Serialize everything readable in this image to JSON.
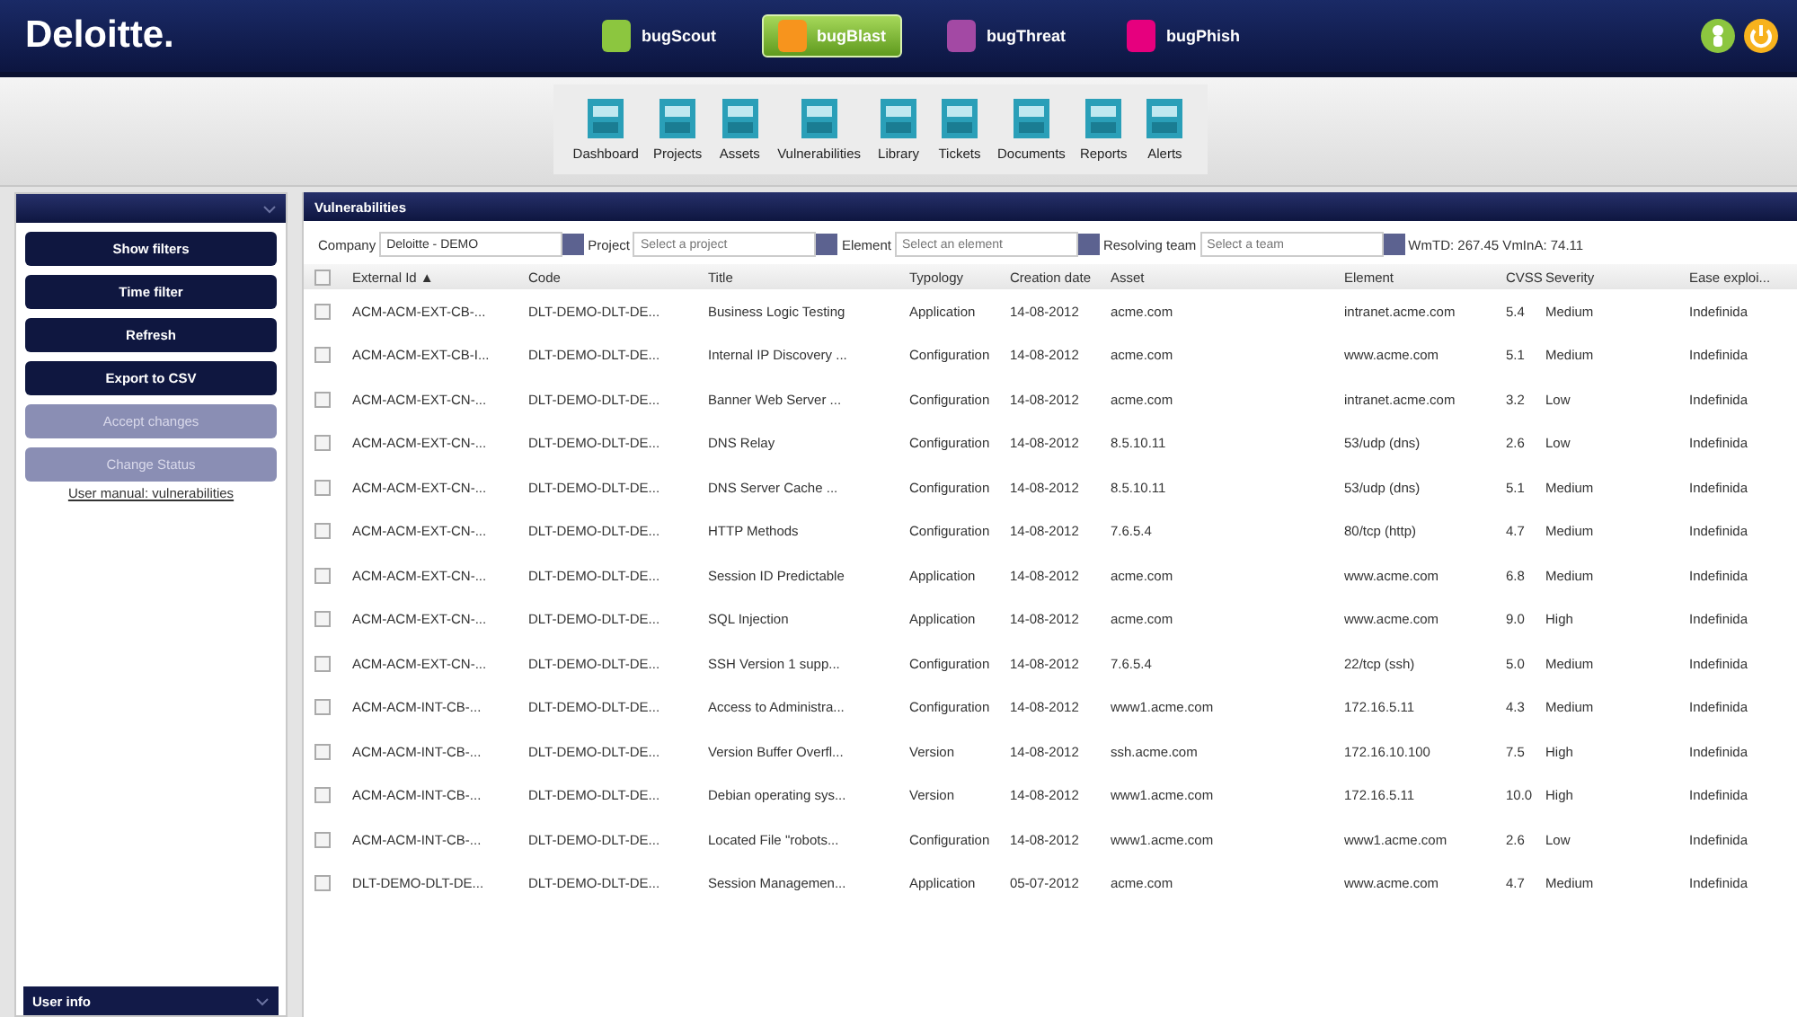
{
  "header": {
    "logo": "Deloitte.",
    "apps": [
      {
        "label": "bugScout",
        "color": "#8cc63f",
        "selected": false
      },
      {
        "label": "bugBlast",
        "color": "#f7941d",
        "selected": true
      },
      {
        "label": "bugThreat",
        "color": "#a349a4",
        "selected": false
      },
      {
        "label": "bugPhish",
        "color": "#e6007e",
        "selected": false
      }
    ]
  },
  "toolbar": [
    "Dashboard",
    "Projects",
    "Assets",
    "Vulnerabilities",
    "Library",
    "Tickets",
    "Documents",
    "Reports",
    "Alerts"
  ],
  "sidebar": {
    "buttons": [
      {
        "label": "Show filters",
        "disabled": false
      },
      {
        "label": "Time filter",
        "disabled": false
      },
      {
        "label": "Refresh",
        "disabled": false
      },
      {
        "label": "Export to CSV",
        "disabled": false
      },
      {
        "label": "Accept changes",
        "disabled": true
      },
      {
        "label": "Change Status",
        "disabled": true
      }
    ],
    "link": "User manual: vulnerabilities",
    "footer": "User info"
  },
  "panel": {
    "title": "Vulnerabilities",
    "filters": [
      {
        "label": "Company",
        "value": "Deloitte - DEMO"
      },
      {
        "label": "Project",
        "placeholder": "Select a project"
      },
      {
        "label": "Element",
        "placeholder": "Select an element"
      },
      {
        "label": "Resolving team",
        "placeholder": "Select a team"
      }
    ],
    "stats": "WmTD: 267.45  VmInA: 74.11",
    "table": {
      "all_checked": false,
      "columns": [
        "External Id ▲",
        "Code",
        "Title",
        "Typology",
        "Creation date",
        "Asset",
        "Element",
        "CVSS",
        "Severity",
        "Ease exploi..."
      ],
      "rows": [
        {
          "checked": false,
          "cells": [
            "ACM-ACM-EXT-CB-...",
            "DLT-DEMO-DLT-DE...",
            "Business Logic Testing",
            "Application",
            "14-08-2012",
            "acme.com",
            "intranet.acme.com",
            "5.4",
            "Medium",
            "Indefinida"
          ]
        },
        {
          "checked": false,
          "cells": [
            "ACM-ACM-EXT-CB-I...",
            "DLT-DEMO-DLT-DE...",
            "Internal IP Discovery ...",
            "Configuration",
            "14-08-2012",
            "acme.com",
            "www.acme.com",
            "5.1",
            "Medium",
            "Indefinida"
          ]
        },
        {
          "checked": false,
          "cells": [
            "ACM-ACM-EXT-CN-...",
            "DLT-DEMO-DLT-DE...",
            "Banner Web Server ...",
            "Configuration",
            "14-08-2012",
            "acme.com",
            "intranet.acme.com",
            "3.2",
            "Low",
            "Indefinida"
          ]
        },
        {
          "checked": false,
          "cells": [
            "ACM-ACM-EXT-CN-...",
            "DLT-DEMO-DLT-DE...",
            "DNS Relay",
            "Configuration",
            "14-08-2012",
            "8.5.10.11",
            "53/udp (dns)",
            "2.6",
            "Low",
            "Indefinida"
          ]
        },
        {
          "checked": false,
          "cells": [
            "ACM-ACM-EXT-CN-...",
            "DLT-DEMO-DLT-DE...",
            "DNS Server Cache ...",
            "Configuration",
            "14-08-2012",
            "8.5.10.11",
            "53/udp (dns)",
            "5.1",
            "Medium",
            "Indefinida"
          ]
        },
        {
          "checked": false,
          "cells": [
            "ACM-ACM-EXT-CN-...",
            "DLT-DEMO-DLT-DE...",
            "HTTP Methods",
            "Configuration",
            "14-08-2012",
            "7.6.5.4",
            "80/tcp (http)",
            "4.7",
            "Medium",
            "Indefinida"
          ]
        },
        {
          "checked": false,
          "cells": [
            "ACM-ACM-EXT-CN-...",
            "DLT-DEMO-DLT-DE...",
            "Session ID Predictable",
            "Application",
            "14-08-2012",
            "acme.com",
            "www.acme.com",
            "6.8",
            "Medium",
            "Indefinida"
          ]
        },
        {
          "checked": false,
          "cells": [
            "ACM-ACM-EXT-CN-...",
            "DLT-DEMO-DLT-DE...",
            "SQL Injection",
            "Application",
            "14-08-2012",
            "acme.com",
            "www.acme.com",
            "9.0",
            "High",
            "Indefinida"
          ]
        },
        {
          "checked": false,
          "cells": [
            "ACM-ACM-EXT-CN-...",
            "DLT-DEMO-DLT-DE...",
            "SSH Version 1 supp...",
            "Configuration",
            "14-08-2012",
            "7.6.5.4",
            "22/tcp (ssh)",
            "5.0",
            "Medium",
            "Indefinida"
          ]
        },
        {
          "checked": false,
          "cells": [
            "ACM-ACM-INT-CB-...",
            "DLT-DEMO-DLT-DE...",
            "Access to Administra...",
            "Configuration",
            "14-08-2012",
            "www1.acme.com",
            "172.16.5.11",
            "4.3",
            "Medium",
            "Indefinida"
          ]
        },
        {
          "checked": false,
          "cells": [
            "ACM-ACM-INT-CB-...",
            "DLT-DEMO-DLT-DE...",
            "Version Buffer Overfl...",
            "Version",
            "14-08-2012",
            "ssh.acme.com",
            "172.16.10.100",
            "7.5",
            "High",
            "Indefinida"
          ]
        },
        {
          "checked": false,
          "cells": [
            "ACM-ACM-INT-CB-...",
            "DLT-DEMO-DLT-DE...",
            "Debian operating sys...",
            "Version",
            "14-08-2012",
            "www1.acme.com",
            "172.16.5.11",
            "10.0",
            "High",
            "Indefinida"
          ]
        },
        {
          "checked": false,
          "cells": [
            "ACM-ACM-INT-CB-...",
            "DLT-DEMO-DLT-DE...",
            "Located File \"robots...",
            "Configuration",
            "14-08-2012",
            "www1.acme.com",
            "www1.acme.com",
            "2.6",
            "Low",
            "Indefinida"
          ]
        },
        {
          "checked": false,
          "cells": [
            "DLT-DEMO-DLT-DE...",
            "DLT-DEMO-DLT-DE...",
            "Session Managemen...",
            "Application",
            "05-07-2012",
            "acme.com",
            "www.acme.com",
            "4.7",
            "Medium",
            "Indefinida"
          ]
        }
      ]
    }
  }
}
